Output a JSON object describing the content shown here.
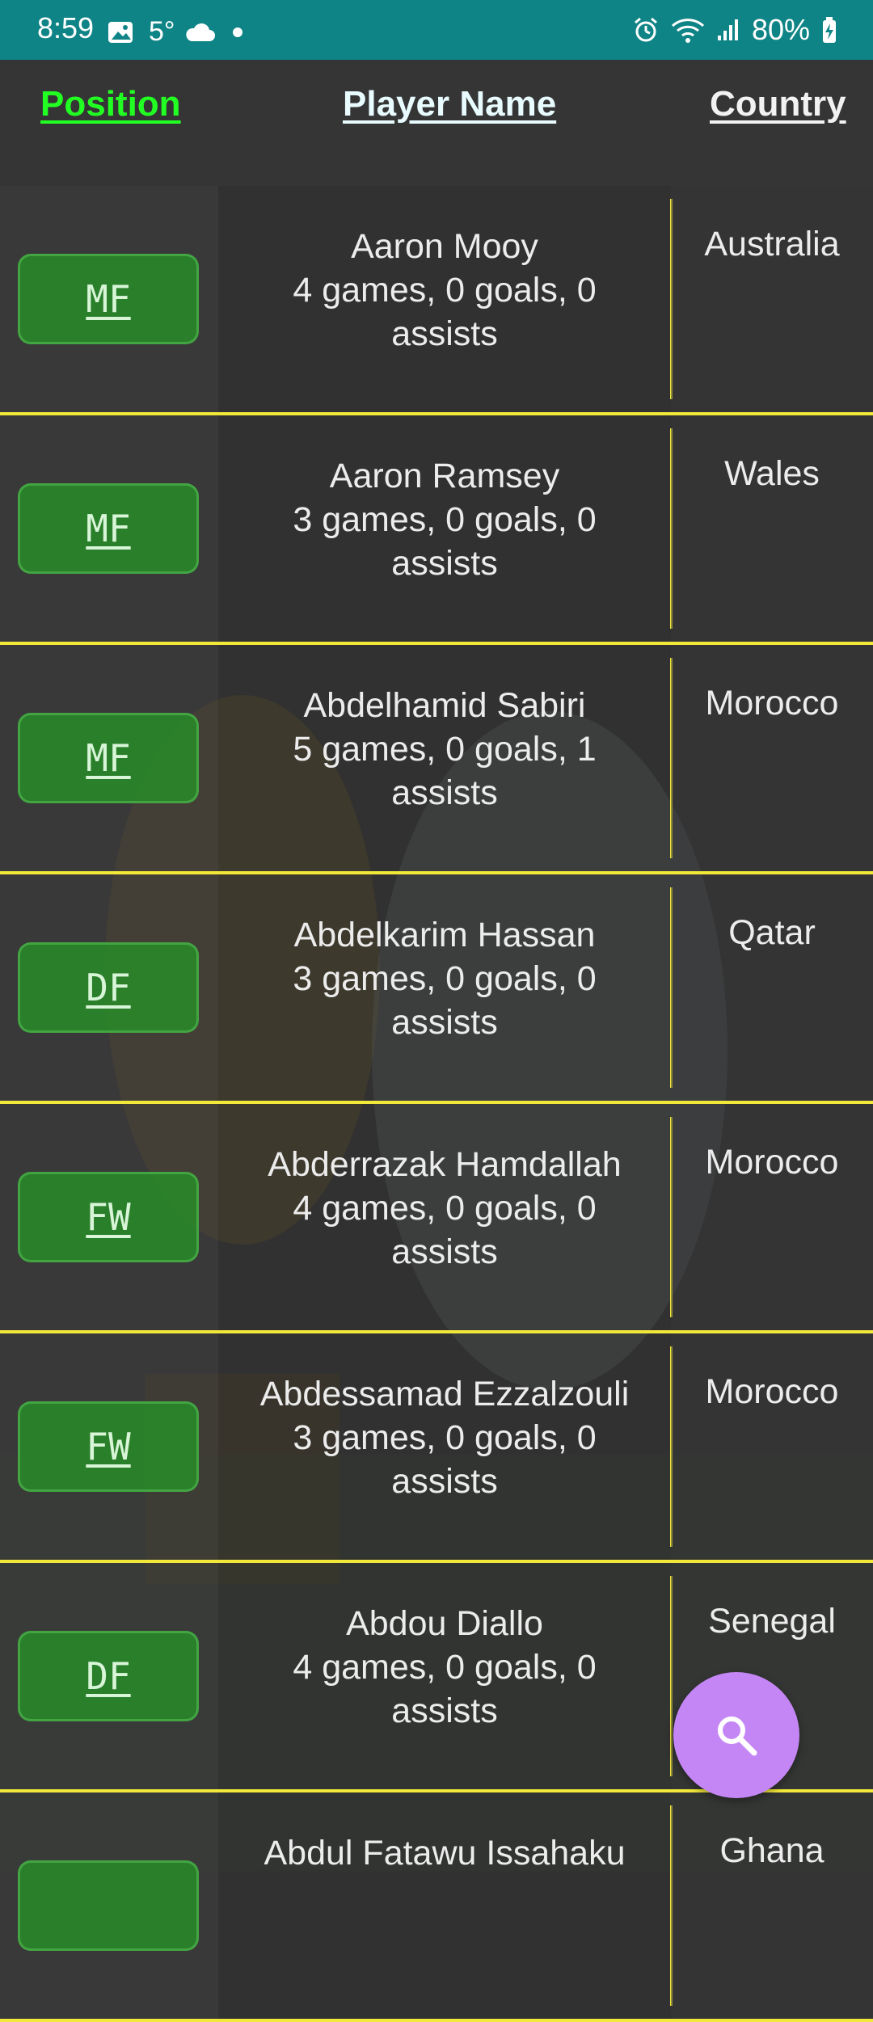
{
  "status_bar": {
    "time": "8:59",
    "temperature": "5°",
    "battery": "80%",
    "icons": [
      "gallery-icon",
      "cloud-icon",
      "dot-icon",
      "alarm-icon",
      "wifi-icon",
      "signal-icon",
      "battery-icon"
    ]
  },
  "header": {
    "position_label": "Position",
    "name_label": "Player Name",
    "country_label": "Country"
  },
  "players": [
    {
      "position": "MF",
      "name": "Aaron Mooy",
      "stats_line1": "4 games, 0 goals, 0",
      "stats_line2": "assists",
      "country": "Australia"
    },
    {
      "position": "MF",
      "name": "Aaron Ramsey",
      "stats_line1": "3 games, 0 goals, 0",
      "stats_line2": "assists",
      "country": "Wales"
    },
    {
      "position": "MF",
      "name": "Abdelhamid Sabiri",
      "stats_line1": "5 games, 0 goals, 1",
      "stats_line2": "assists",
      "country": "Morocco"
    },
    {
      "position": "DF",
      "name": "Abdelkarim Hassan",
      "stats_line1": "3 games, 0 goals, 0",
      "stats_line2": "assists",
      "country": "Qatar"
    },
    {
      "position": "FW",
      "name": "Abderrazak Hamdallah",
      "stats_line1": "4 games, 0 goals, 0",
      "stats_line2": "assists",
      "country": "Morocco"
    },
    {
      "position": "FW",
      "name": "Abdessamad Ezzalzouli",
      "stats_line1": "3 games, 0 goals, 0",
      "stats_line2": "assists",
      "country": "Morocco"
    },
    {
      "position": "DF",
      "name": "Abdou Diallo",
      "stats_line1": "4 games, 0 goals, 0",
      "stats_line2": "assists",
      "country": "Senegal"
    },
    {
      "position": "",
      "name": "Abdul Fatawu Issahaku",
      "stats_line1": "",
      "stats_line2": "",
      "country": "Ghana"
    }
  ],
  "search_fab": {
    "icon": "search-icon",
    "color": "#c586f5"
  },
  "colors": {
    "status_bar": "#0f8486",
    "divider": "#f2e83a",
    "position_header": "#22ff22",
    "position_button": "#2a8c2a"
  }
}
